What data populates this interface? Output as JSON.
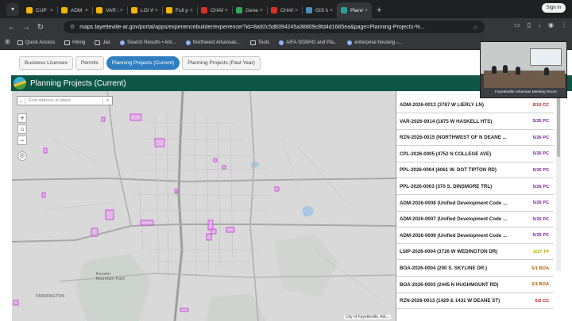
{
  "browser": {
    "tabs": [
      {
        "title": "CUP 2",
        "color": "#f4b400",
        "active": false
      },
      {
        "title": "ADM",
        "color": "#f4b400",
        "active": false
      },
      {
        "title": "VAR 2",
        "color": "#f4b400",
        "active": false
      },
      {
        "title": "LOI W",
        "color": "#f4b400",
        "active": false
      },
      {
        "title": "Full p",
        "color": "#f4b400",
        "active": false
      },
      {
        "title": "CHAP",
        "color": "#d93025",
        "active": false
      },
      {
        "title": "Gene",
        "color": "#34a853",
        "active": false
      },
      {
        "title": "CHAP",
        "color": "#d93025",
        "active": false
      },
      {
        "title": "GIS M",
        "color": "#4a90c2",
        "active": false
      },
      {
        "title": "Plann",
        "color": "#2aa198",
        "active": true
      }
    ],
    "new_tab": "+",
    "sign_in": "Sign in",
    "url": "maps.fayetteville-ar.gov/portal/apps/experiencebuilder/experience/?id=8a92c5d8394245a38809c8fd4d1685ea&page=Planning-Projects-%...",
    "bookmarks": [
      {
        "label": "Quick Access",
        "icon": "folder-icon"
      },
      {
        "label": "Hiring",
        "icon": "folder-icon"
      },
      {
        "label": "Jax",
        "icon": "folder-icon"
      },
      {
        "label": "Search Results • Ark...",
        "icon": "page-icon"
      },
      {
        "label": "Northwest Arkansas...",
        "icon": "page-icon"
      },
      {
        "label": "Tools",
        "icon": "folder-icon"
      },
      {
        "label": "AIFA SGBHO and Pla...",
        "icon": "page-icon"
      },
      {
        "label": "enterprise housing -...",
        "icon": "wordpress-icon"
      }
    ]
  },
  "app": {
    "tabs": [
      {
        "label": "Business Licenses",
        "active": false
      },
      {
        "label": "Permits",
        "active": false
      },
      {
        "label": "Planning Projects (Current)",
        "active": true
      },
      {
        "label": "Planning Projects (Past Year)",
        "active": false
      }
    ],
    "header_title": "Planning Projects (Current)",
    "header_color": "#0f5646"
  },
  "map": {
    "search_placeholder": "Find address or place",
    "attribution": "City of Fayetteville, Ark...",
    "place_labels": [
      "Kessler Mountain Park",
      "FARMINGTON"
    ]
  },
  "projects": [
    {
      "name": "ADM-2026-0013 (3787 W LIERLY LN)",
      "date": "6/10 CC",
      "color": "#b22222"
    },
    {
      "name": "VAR-2026-0014 (1875 W HASKELL HTS)",
      "date": "5/26 PC",
      "color": "#7b1fa2"
    },
    {
      "name": "RZN-2026-0015 (NORTHWEST OF N DEANE ...",
      "date": "5/26 PC",
      "color": "#7b1fa2"
    },
    {
      "name": "CPL-2026-0005 (4752 N COLLEGE AVE)",
      "date": "5/26 PC",
      "color": "#7b1fa2"
    },
    {
      "name": "PPL-2026-0004 (6061 W. DOT TIPTON RD)",
      "date": "5/26 PC",
      "color": "#7b1fa2"
    },
    {
      "name": "PPL-2026-0003 (370 S. DINSMORE TRL)",
      "date": "5/26 PC",
      "color": "#7b1fa2"
    },
    {
      "name": "ADM-2026-0008 (Unified Development Code ...",
      "date": "5/26 PC",
      "color": "#7b1fa2"
    },
    {
      "name": "ADM-2026-0007 (Unified Development Code ...",
      "date": "5/26 PC",
      "color": "#7b1fa2"
    },
    {
      "name": "ADM-2026-0009 (Unified Development Code ...",
      "date": "5/26 PC",
      "color": "#7b1fa2"
    },
    {
      "name": "LSIP-2026-0004 (3726 W WEDINGTON DR)",
      "date": "5/27 TP",
      "color": "#b8a000"
    },
    {
      "name": "BOA-2026-0004 (200 S. SKYLINE DR.)",
      "date": "6/1 BOA",
      "color": "#c25b00"
    },
    {
      "name": "BOA-2026-0003 (2445 N HUGHMOUNT RD)",
      "date": "6/1 BOA",
      "color": "#c25b00"
    },
    {
      "name": "RZN-2026-0013 (1429 & 1431 W DEANE ST)",
      "date": "6/2 CC",
      "color": "#b22222"
    }
  ],
  "video": {
    "caption": "Fayetteville Arkansas Meeting Room"
  }
}
